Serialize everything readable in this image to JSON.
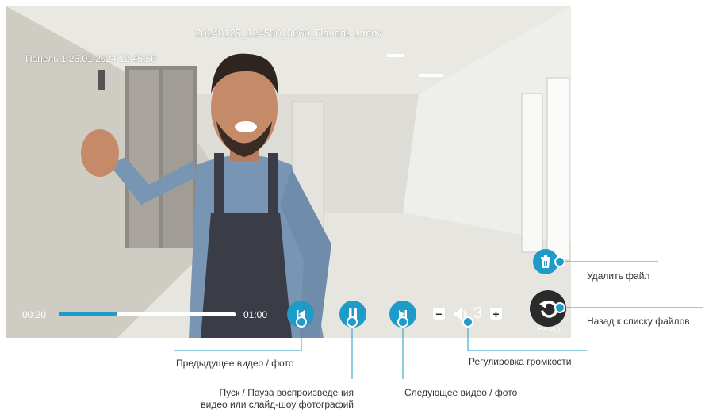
{
  "video": {
    "filename": "20240125_124530_0060_Панель 1.mov",
    "overlay_timestamp": "Панель 1 25.01.2024 12:45:50"
  },
  "player": {
    "current_time": "00:20",
    "total_time": "01:00",
    "progress": 0.33,
    "volume": "3",
    "back_label": "Назад"
  },
  "icons": {
    "prev": "skip-previous-icon",
    "play_pause": "pause-icon",
    "next": "skip-next-icon",
    "volume_down": "minus-icon",
    "volume": "speaker-icon",
    "volume_up": "plus-icon",
    "delete": "trash-icon",
    "back": "undo-arrow-icon"
  },
  "annotations": {
    "delete_file": "Удалить файл",
    "back_to_list": "Назад к списку файлов",
    "prev": "Предыдущее видео / фото",
    "volume": "Регулировка громкости",
    "play_pause_line1": "Пуск / Пауза воспроизведения",
    "play_pause_line2": "видео или слайд-шоу фотографий",
    "next": "Следующее видео / фото"
  },
  "colors": {
    "accent": "#1e9bc8",
    "back_button": "#2a2a2a",
    "annotation_line": "#1e9bc8"
  }
}
